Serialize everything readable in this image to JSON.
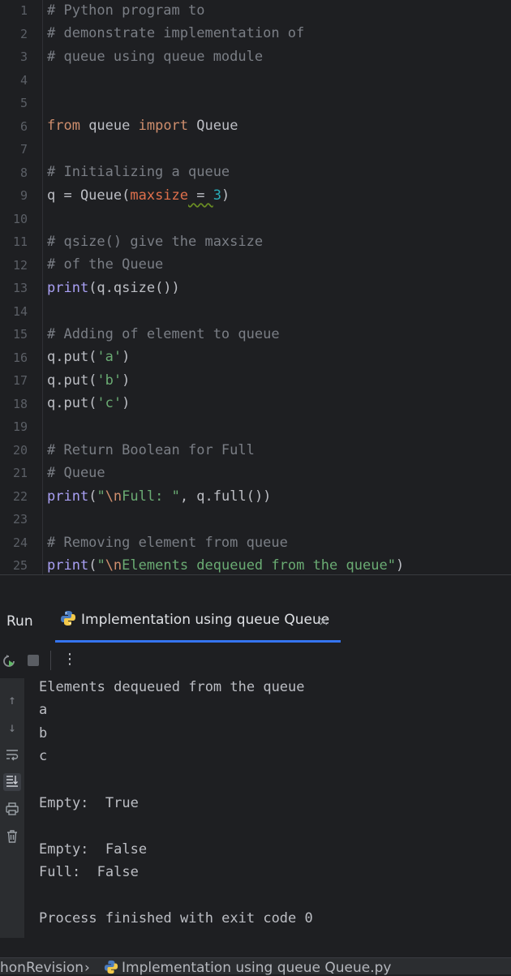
{
  "editor": {
    "line_numbers": [
      "1",
      "2",
      "3",
      "4",
      "5",
      "6",
      "7",
      "8",
      "9",
      "10",
      "11",
      "12",
      "13",
      "14",
      "15",
      "16",
      "17",
      "18",
      "19",
      "20",
      "21",
      "22",
      "23",
      "24",
      "25"
    ],
    "lines": {
      "l1": "# Python program to",
      "l2": "# demonstrate implementation of",
      "l3": "# queue using queue module",
      "l6_kw1": "from",
      "l6_mid": " queue ",
      "l6_kw2": "import",
      "l6_end": " Queue",
      "l8": "# Initializing a queue",
      "l9_a": "q = Queue(",
      "l9_param": "maxsize",
      "l9_eq": " = ",
      "l9_num": "3",
      "l9_close": ")",
      "l11": "# qsize() give the maxsize",
      "l12": "# of the Queue",
      "l13_fn": "print",
      "l13_rest": "(q.qsize())",
      "l15": "# Adding of element to queue",
      "l16_a": "q.put(",
      "l16_s": "'a'",
      "l17_s": "'b'",
      "l18_s": "'c'",
      "paren_close": ")",
      "l20": "# Return Boolean for Full",
      "l21": "# Queue",
      "l22_fn": "print",
      "l22_open": "(",
      "l22_s1": "\"",
      "l22_esc": "\\n",
      "l22_s2": "Full: \"",
      "l22_rest": ", q.full())",
      "l24": "# Removing element from queue",
      "l25_fn": "print",
      "l25_open": "(",
      "l25_s1": "\"",
      "l25_esc": "\\n",
      "l25_s2": "Elements dequeued from the queue\"",
      "l25_close": ")"
    }
  },
  "run_panel": {
    "title": "Run",
    "tab_label": "Implementation using queue Queue",
    "tab_close": "×",
    "more": "⋮"
  },
  "console": {
    "lines": [
      "Elements dequeued from the queue",
      "a",
      "b",
      "c",
      "",
      "Empty:  True",
      "",
      "Empty:  False",
      "Full:  False",
      "",
      "Process finished with exit code 0"
    ]
  },
  "statusbar": {
    "project": "honRevision",
    "separator": "›",
    "file": "Implementation using queue Queue.py"
  },
  "colors": {
    "background": "#1e1f22",
    "comment": "#7a7e85",
    "keyword": "#cf8e6d",
    "function": "#a9a0f4",
    "string": "#6aab73",
    "number": "#2aacb8",
    "accent": "#3574f0"
  }
}
